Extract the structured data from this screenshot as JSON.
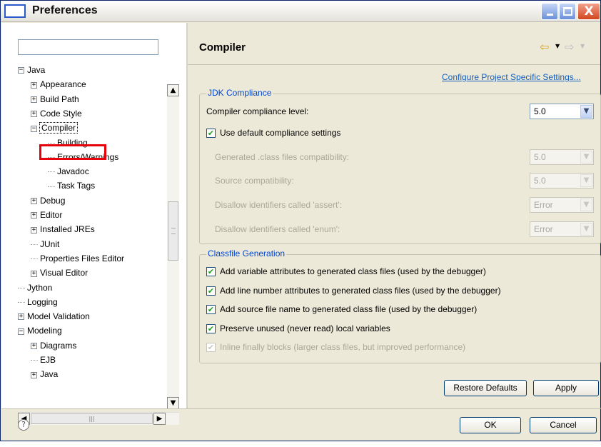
{
  "window": {
    "title": "Preferences",
    "close_glyph": "X"
  },
  "left": {
    "filter_value": "",
    "tree": [
      {
        "label": "Java",
        "expander": "−",
        "level": 0
      },
      {
        "label": "Appearance",
        "expander": "+",
        "level": 1
      },
      {
        "label": "Build Path",
        "expander": "+",
        "level": 1
      },
      {
        "label": "Code Style",
        "expander": "+",
        "level": 1
      },
      {
        "label": "Compiler",
        "expander": "−",
        "level": 1,
        "selected": true
      },
      {
        "label": "Building",
        "level": 2
      },
      {
        "label": "Errors/Warnings",
        "level": 2
      },
      {
        "label": "Javadoc",
        "level": 2
      },
      {
        "label": "Task Tags",
        "level": 2
      },
      {
        "label": "Debug",
        "expander": "+",
        "level": 1
      },
      {
        "label": "Editor",
        "expander": "+",
        "level": 1
      },
      {
        "label": "Installed JREs",
        "expander": "+",
        "level": 1
      },
      {
        "label": "JUnit",
        "level": 1
      },
      {
        "label": "Properties Files Editor",
        "level": 1
      },
      {
        "label": "Visual Editor",
        "expander": "+",
        "level": 1
      },
      {
        "label": "Jython",
        "level": 0
      },
      {
        "label": "Logging",
        "level": 0
      },
      {
        "label": "Model Validation",
        "expander": "+",
        "level": 0
      },
      {
        "label": "Modeling",
        "expander": "−",
        "level": 0
      },
      {
        "label": "Diagrams",
        "expander": "+",
        "level": 1
      },
      {
        "label": "EJB",
        "level": 1
      },
      {
        "label": "Java",
        "expander": "+",
        "level": 1
      }
    ]
  },
  "right": {
    "title": "Compiler",
    "configure_link": "Configure Project Specific Settings...",
    "jdk": {
      "legend": "JDK Compliance",
      "compliance_label": "Compiler compliance level:",
      "compliance_value": "5.0",
      "use_default_label": "Use default compliance settings",
      "generated_label": "Generated .class files compatibility:",
      "generated_value": "5.0",
      "source_label": "Source compatibility:",
      "source_value": "5.0",
      "assert_label": "Disallow identifiers called 'assert':",
      "assert_value": "Error",
      "enum_label": "Disallow identifiers called 'enum':",
      "enum_value": "Error"
    },
    "classfile": {
      "legend": "Classfile Generation",
      "options": [
        {
          "label": "Add variable attributes to generated class files (used by the debugger)",
          "checked": true,
          "enabled": true
        },
        {
          "label": "Add line number attributes to generated class files (used by the debugger)",
          "checked": true,
          "enabled": true
        },
        {
          "label": "Add source file name to generated class file (used by the debugger)",
          "checked": true,
          "enabled": true
        },
        {
          "label": "Preserve unused (never read) local variables",
          "checked": true,
          "enabled": true
        },
        {
          "label": "Inline finally blocks (larger class files, but improved performance)",
          "checked": true,
          "enabled": false
        }
      ]
    },
    "restore_defaults": "Restore Defaults",
    "apply": "Apply"
  },
  "footer": {
    "help_glyph": "?",
    "ok": "OK",
    "cancel": "Cancel"
  },
  "glyphs": {
    "check": "✔",
    "dropdown": "▼",
    "back_arrow": "⇦",
    "forward_arrow": "⇨",
    "small_dd": "▼",
    "up": "▲",
    "down": "▼",
    "left": "◀",
    "right": "▶",
    "hthumb": "|||"
  },
  "colors": {
    "accent_blue": "#0046d5",
    "link": "#1560bd",
    "selection_box": "#e8000b",
    "check_green": "#21a121"
  }
}
